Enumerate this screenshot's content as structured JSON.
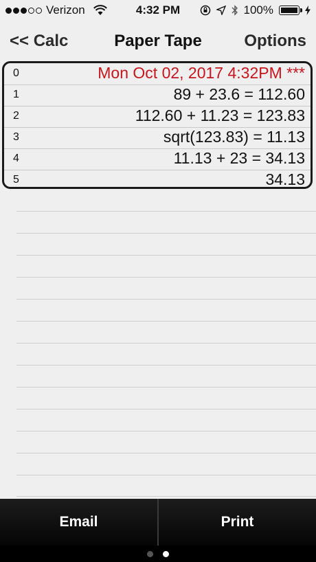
{
  "status": {
    "carrier": "Verizon",
    "signal_filled": 3,
    "signal_total": 5,
    "time": "4:32 PM",
    "battery": "100%",
    "battery_level": 1.0
  },
  "nav": {
    "back_label": "<< Calc",
    "title": "Paper Tape",
    "options_label": "Options"
  },
  "tape": {
    "rows": [
      {
        "num": "0",
        "text": "Mon Oct 02, 2017 4:32PM ***",
        "highlight": true
      },
      {
        "num": "1",
        "text": "89 + 23.6 = 112.60",
        "highlight": false
      },
      {
        "num": "2",
        "text": "112.60 + 11.23 = 123.83",
        "highlight": false
      },
      {
        "num": "3",
        "text": "sqrt(123.83) = 11.13",
        "highlight": false
      },
      {
        "num": "4",
        "text": "11.13 + 23 = 34.13",
        "highlight": false
      },
      {
        "num": "5",
        "text": "34.13",
        "highlight": false
      }
    ]
  },
  "toolbar": {
    "email_label": "Email",
    "print_label": "Print"
  },
  "pager": {
    "total": 2,
    "active": 1
  },
  "colors": {
    "highlight": "#c4161c",
    "background": "#efefef"
  }
}
